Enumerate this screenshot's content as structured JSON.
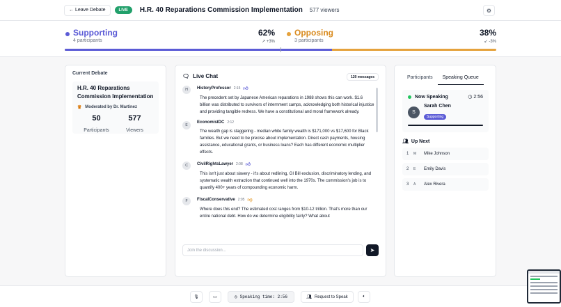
{
  "header": {
    "leave_label": "← Leave Debate",
    "live_label": "LIVE",
    "title": "H.R. 40 Reparations Commission Implementation",
    "viewers": "577 viewers",
    "settings_icon": "gear-icon"
  },
  "stats": {
    "supporting": {
      "label": "Supporting",
      "participants": "4 participants",
      "percent": "62%",
      "trend": "↗ +3%",
      "color": "#5b5bd6"
    },
    "opposing": {
      "label": "Opposing",
      "participants": "3 participants",
      "percent": "38%",
      "trend": "↙ -3%",
      "color": "#e5a23c"
    },
    "support_fraction": 0.62
  },
  "current_debate": {
    "heading": "Current Debate",
    "title": "H.R. 40 Reparations Commission Implementation",
    "moderator": "Moderated by Dr. Martinez",
    "participants_value": "50",
    "participants_label": "Participants",
    "viewers_value": "577",
    "viewers_label": "Viewers"
  },
  "chat": {
    "title": "Live Chat",
    "count": "120 messages",
    "input_placeholder": "Join the discussion...",
    "messages": [
      {
        "initial": "H",
        "author": "HistoryProfessor",
        "time": "2:15",
        "reaction": "thumbs-up",
        "text": "The precedent set by Japanese American reparations in 1988 shows this can work. $1.6 billion was distributed to survivors of internment camps, acknowledging both historical injustice and providing tangible redress. We have a constitutional and moral framework already."
      },
      {
        "initial": "E",
        "author": "EconomistDC",
        "time": "2:12",
        "reaction": "",
        "text": "The wealth gap is staggering - median white family wealth is $171,000 vs $17,600 for Black families. But we need to be precise about implementation. Direct cash payments, housing assistance, educational grants, or business loans? Each has different economic multiplier effects."
      },
      {
        "initial": "C",
        "author": "CivilRightsLawyer",
        "time": "2:08",
        "reaction": "thumbs-up",
        "text": "This isn't just about slavery - it's about redlining, GI Bill exclusion, discriminatory lending, and systematic wealth extraction that continued well into the 1970s. The commission's job is to quantify 400+ years of compounding economic harm."
      },
      {
        "initial": "F",
        "author": "FiscalConservative",
        "time": "2:05",
        "reaction": "thumbs-down",
        "text": "Where does this end? The estimated cost ranges from $10-12 trillion. That's more than our entire national debt. How do we determine eligibility fairly? What about"
      }
    ]
  },
  "queue": {
    "tab_participants": "Participants",
    "tab_queue": "Speaking Queue",
    "now_speaking_label": "Now Speaking",
    "timer": "2:56",
    "speaker_initial": "S",
    "speaker_name": "Sarah Chen",
    "speaker_side": "Supporting",
    "up_next_label": "Up Next",
    "items": [
      {
        "num": "1",
        "initial": "M",
        "name": "Mike Johnson"
      },
      {
        "num": "2",
        "initial": "E",
        "name": "Emily Davis"
      },
      {
        "num": "3",
        "initial": "A",
        "name": "Alex Rivera"
      }
    ]
  },
  "controls": {
    "speaking_time": "Speaking time: 2:56",
    "request_label": "Request to Speak"
  }
}
